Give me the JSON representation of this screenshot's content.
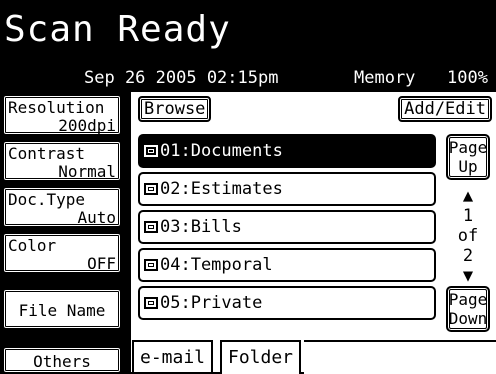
{
  "header": {
    "title": "Scan Ready"
  },
  "status": {
    "date": "Sep 26 2005 02:15pm",
    "memory_label": "Memory",
    "memory_value": "100%"
  },
  "settings": {
    "resolution": {
      "label": "Resolution",
      "value": "200dpi"
    },
    "contrast": {
      "label": "Contrast",
      "value": "Normal"
    },
    "doc_type": {
      "label": "Doc.Type",
      "value": "Auto"
    },
    "color": {
      "label": "Color",
      "value": "OFF"
    },
    "file_name": {
      "label": "File Name"
    },
    "others": {
      "label": "Others"
    }
  },
  "toolbar": {
    "browse_label": "Browse",
    "add_edit_label": "Add/Edit"
  },
  "folders": [
    {
      "label": "01:Documents",
      "selected": true
    },
    {
      "label": "02:Estimates",
      "selected": false
    },
    {
      "label": "03:Bills",
      "selected": false
    },
    {
      "label": "04:Temporal",
      "selected": false
    },
    {
      "label": "05:Private",
      "selected": false
    }
  ],
  "pager": {
    "page_up_line1": "Page",
    "page_up_line2": "Up",
    "up_arrow": "▲",
    "current": "1",
    "of": "of",
    "total": "2",
    "down_arrow": "▼",
    "page_down_line1": "Page",
    "page_down_line2": "Down"
  },
  "tabs": [
    {
      "label": "e-mail"
    },
    {
      "label": "Folder"
    }
  ],
  "icons": {
    "folder": "folder-icon",
    "scroll_up": "up-arrow-icon",
    "scroll_down": "down-arrow-icon"
  }
}
